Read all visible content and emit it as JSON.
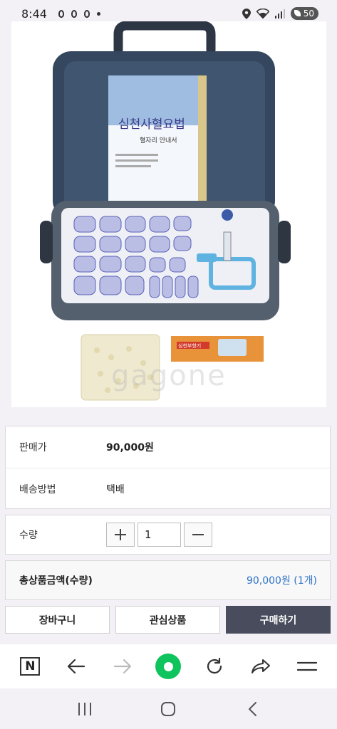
{
  "status_bar": {
    "time": "8:44",
    "battery": "50",
    "icons": [
      "notification-icon",
      "notification-icon",
      "notification-icon",
      "dot-icon",
      "location-icon",
      "wifi-icon",
      "signal-icon",
      "battery-icon"
    ]
  },
  "product_image": {
    "watermark": "gagone",
    "manual_title": "심천사혈요법",
    "manual_subtitle": "혈자리 안내서",
    "package_label": "심천부항기"
  },
  "info": {
    "price_label": "판매가",
    "price_value": "90,000원",
    "shipping_label": "배송방법",
    "shipping_value": "택배"
  },
  "quantity": {
    "label": "수량",
    "value": "1",
    "plus_icon": "plus-icon",
    "minus_icon": "minus-icon"
  },
  "total": {
    "label": "총상품금액(수량)",
    "value": "90,000원 (1개)"
  },
  "buttons": {
    "cart": "장바구니",
    "wishlist": "관심상품",
    "buy": "구매하기"
  },
  "browser_toolbar": {
    "items": [
      "naver-icon",
      "back-icon",
      "forward-icon",
      "green-dot-icon",
      "refresh-icon",
      "share-icon",
      "menu-icon"
    ]
  },
  "nav_bar": {
    "items": [
      "recent-apps-icon",
      "home-icon",
      "back-icon"
    ]
  },
  "colors": {
    "accent_blue": "#2e72c8",
    "primary_button": "#484c5c",
    "green": "#0fc35d"
  }
}
